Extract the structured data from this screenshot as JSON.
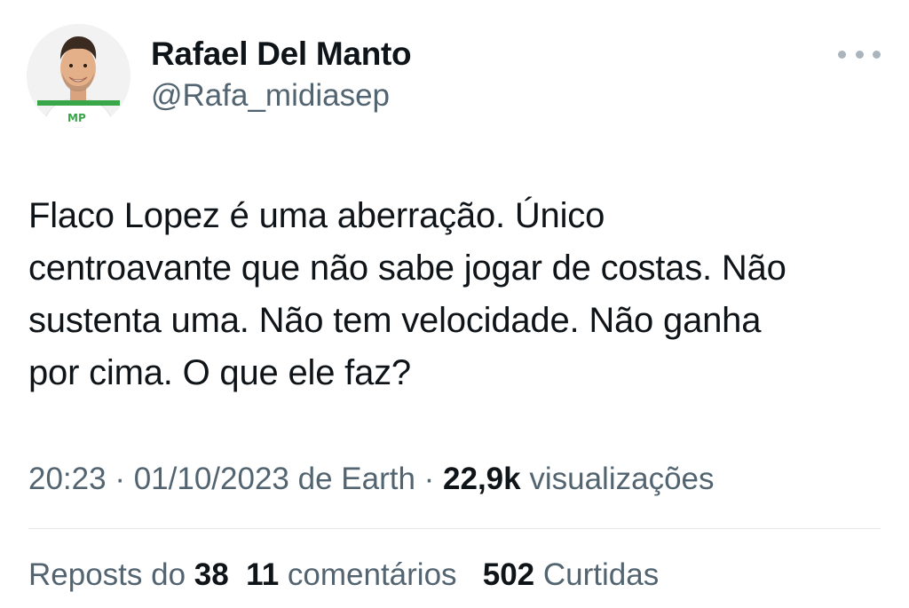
{
  "author": {
    "name": "Rafael Del Manto",
    "handle": "@Rafa_midiasep",
    "avatar_badge": "MP"
  },
  "tweet": {
    "text": "Flaco Lopez é uma aberração. Único\ncentroavante que não sabe jogar de costas. Não\nsustenta uma. Não tem velocidade. Não ganha\npor cima. O que ele faz?"
  },
  "meta": {
    "time": "20:23",
    "separator": " · ",
    "date": "01/10/2023",
    "source_prefix": " de ",
    "source": "Earth",
    "views_count": "22,9k",
    "views_label": " visualizações"
  },
  "stats": {
    "reposts_label": "Reposts do ",
    "reposts_count": "38",
    "comments_count": "11",
    "comments_label": " comentários",
    "likes_count": "502",
    "likes_label": " Curtidas"
  },
  "colors": {
    "primary_text": "#0f1419",
    "secondary_text": "#536471",
    "badge_green": "#3aa64a"
  },
  "icons": {
    "more": "more-horizontal-icon"
  }
}
